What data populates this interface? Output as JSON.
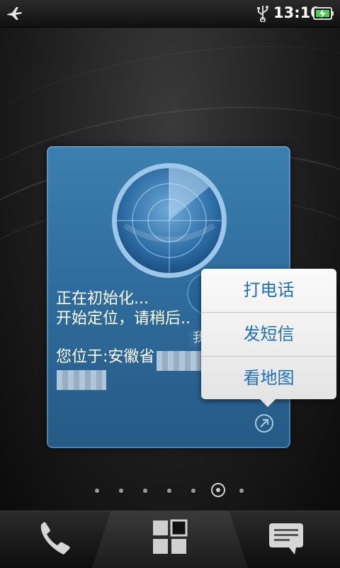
{
  "status_bar": {
    "time": "13:10",
    "icons": [
      "airplane-mode-icon",
      "usb-icon",
      "battery-charging-icon"
    ],
    "battery_color": "#3fd34b"
  },
  "widget": {
    "lines": [
      "正在初始化...",
      "开始定位，请稍后..",
      "您位于:安徽省"
    ],
    "ghost_label": "我",
    "icons": [
      "radar-icon",
      "share-icon"
    ],
    "accent": "#2f6d9e"
  },
  "popup_menu": {
    "items": [
      "打电话",
      "发短信",
      "看地图"
    ],
    "text_color": "#1f6fb3"
  },
  "page_indicator": {
    "count": 7,
    "active_index": 5
  },
  "dock": {
    "items": [
      "phone-icon",
      "all-apps-icon",
      "messages-icon"
    ]
  }
}
